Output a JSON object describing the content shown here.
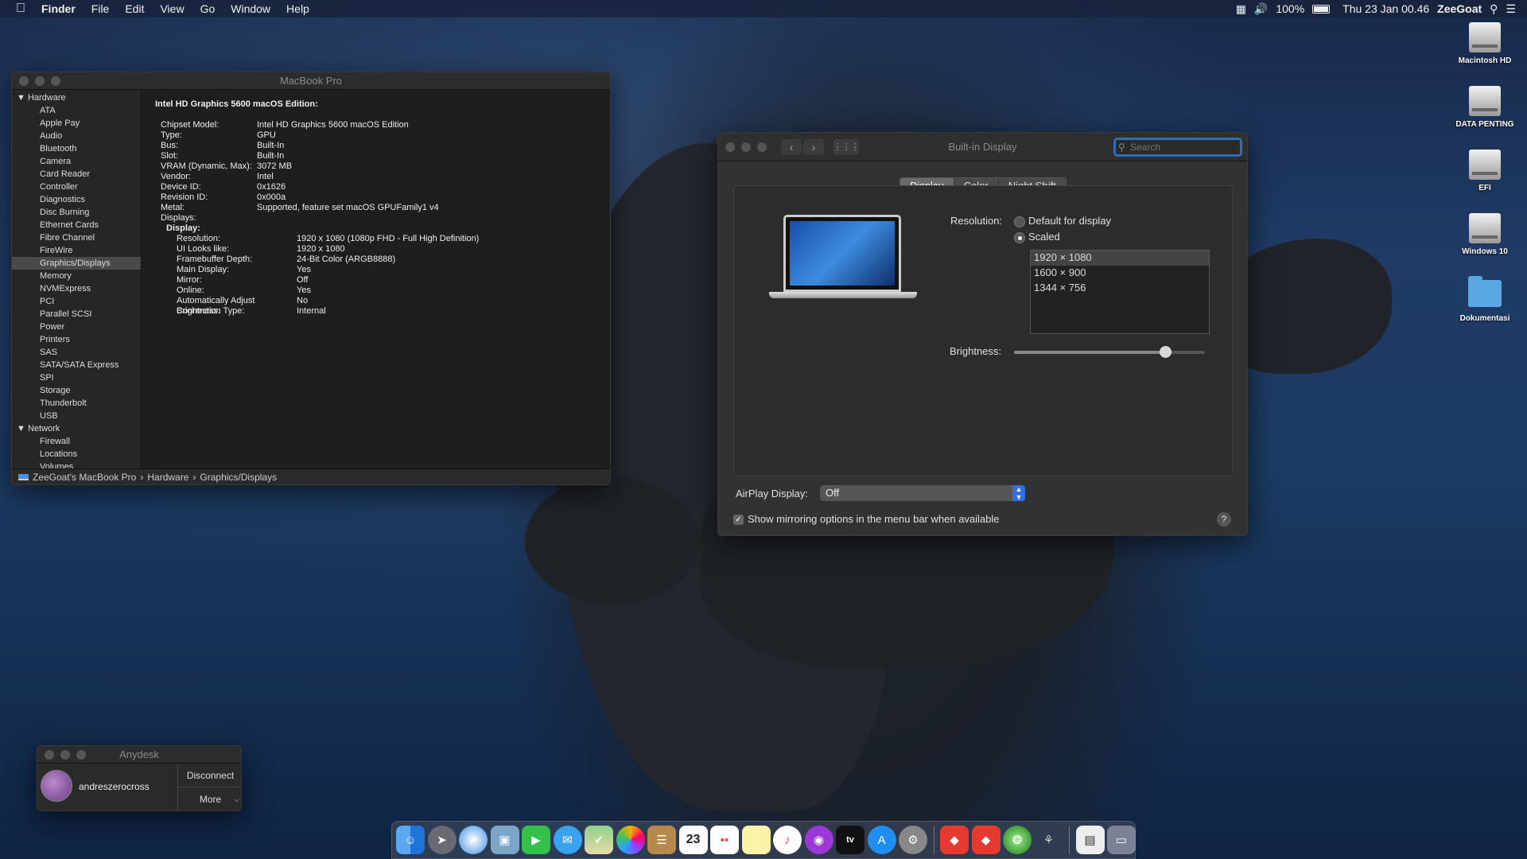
{
  "menubar": {
    "app_name": "Finder",
    "menus": [
      "File",
      "Edit",
      "View",
      "Go",
      "Window",
      "Help"
    ],
    "battery": "100%",
    "datetime": "Thu 23 Jan  00.46",
    "user": "ZeeGoat"
  },
  "desktop_icons": [
    {
      "label": "Macintosh HD",
      "kind": "drive"
    },
    {
      "label": "DATA PENTING",
      "kind": "drive"
    },
    {
      "label": "EFI",
      "kind": "drive"
    },
    {
      "label": "Windows 10",
      "kind": "drive"
    },
    {
      "label": "Dokumentasi",
      "kind": "folder"
    }
  ],
  "sysinfo": {
    "title": "MacBook Pro",
    "sidebar": {
      "hardware_header": "Hardware",
      "hardware_items": [
        "ATA",
        "Apple Pay",
        "Audio",
        "Bluetooth",
        "Camera",
        "Card Reader",
        "Controller",
        "Diagnostics",
        "Disc Burning",
        "Ethernet Cards",
        "Fibre Channel",
        "FireWire",
        "Graphics/Displays",
        "Memory",
        "NVMExpress",
        "PCI",
        "Parallel SCSI",
        "Power",
        "Printers",
        "SAS",
        "SATA/SATA Express",
        "SPI",
        "Storage",
        "Thunderbolt",
        "USB"
      ],
      "selected": "Graphics/Displays",
      "network_header": "Network",
      "network_items": [
        "Firewall",
        "Locations",
        "Volumes"
      ]
    },
    "detail": {
      "heading": "Intel HD Graphics 5600 macOS Edition:",
      "fields": [
        {
          "k": "Chipset Model:",
          "v": "Intel HD Graphics 5600 macOS Edition"
        },
        {
          "k": "Type:",
          "v": "GPU"
        },
        {
          "k": "Bus:",
          "v": "Built-In"
        },
        {
          "k": "Slot:",
          "v": "Built-In"
        },
        {
          "k": "VRAM (Dynamic, Max):",
          "v": "3072 MB"
        },
        {
          "k": "Vendor:",
          "v": "Intel"
        },
        {
          "k": "Device ID:",
          "v": "0x1626"
        },
        {
          "k": "Revision ID:",
          "v": "0x000a"
        },
        {
          "k": "Metal:",
          "v": "Supported, feature set macOS GPUFamily1 v4"
        }
      ],
      "displays_label": "Displays:",
      "display_label": "Display:",
      "display_fields": [
        {
          "k": "Resolution:",
          "v": "1920 x 1080 (1080p FHD - Full High Definition)"
        },
        {
          "k": "UI Looks like:",
          "v": "1920 x 1080"
        },
        {
          "k": "Framebuffer Depth:",
          "v": "24-Bit Color (ARGB8888)"
        },
        {
          "k": "Main Display:",
          "v": "Yes"
        },
        {
          "k": "Mirror:",
          "v": "Off"
        },
        {
          "k": "Online:",
          "v": "Yes"
        },
        {
          "k": "Automatically Adjust Brightness:",
          "v": "No"
        },
        {
          "k": "Connection Type:",
          "v": "Internal"
        }
      ]
    },
    "path": [
      "ZeeGoat's MacBook Pro",
      "Hardware",
      "Graphics/Displays"
    ]
  },
  "display_prefs": {
    "title": "Built-in Display",
    "search_placeholder": "Search",
    "tabs": [
      "Display",
      "Color",
      "Night Shift"
    ],
    "active_tab": "Display",
    "resolution_label": "Resolution:",
    "option_default": "Default for display",
    "option_scaled": "Scaled",
    "resolutions": [
      "1920 × 1080",
      "1600 × 900",
      "1344 × 756"
    ],
    "selected_resolution": "1920 × 1080",
    "brightness_label": "Brightness:",
    "brightness_level": 0.79,
    "airplay_label": "AirPlay Display:",
    "airplay_value": "Off",
    "mirror_checkbox_label": "Show mirroring options in the menu bar when available",
    "mirror_checked": true,
    "help": "?"
  },
  "anydesk": {
    "title": "Anydesk",
    "username": "andreszerocross",
    "disconnect": "Disconnect",
    "more": "More"
  },
  "dock": {
    "calendar_day": "23",
    "appletv": "tv",
    "apps": [
      "finder",
      "launchpad",
      "safari",
      "preview",
      "facetime",
      "messages",
      "maps",
      "photos",
      "notes",
      "calendar",
      "reminders",
      "stickies",
      "itunes",
      "podcasts",
      "appletv",
      "appstore",
      "system-preferences",
      "anydesk",
      "anydesk-2",
      "network-radar",
      "ios-app",
      "documents",
      "trash"
    ]
  }
}
